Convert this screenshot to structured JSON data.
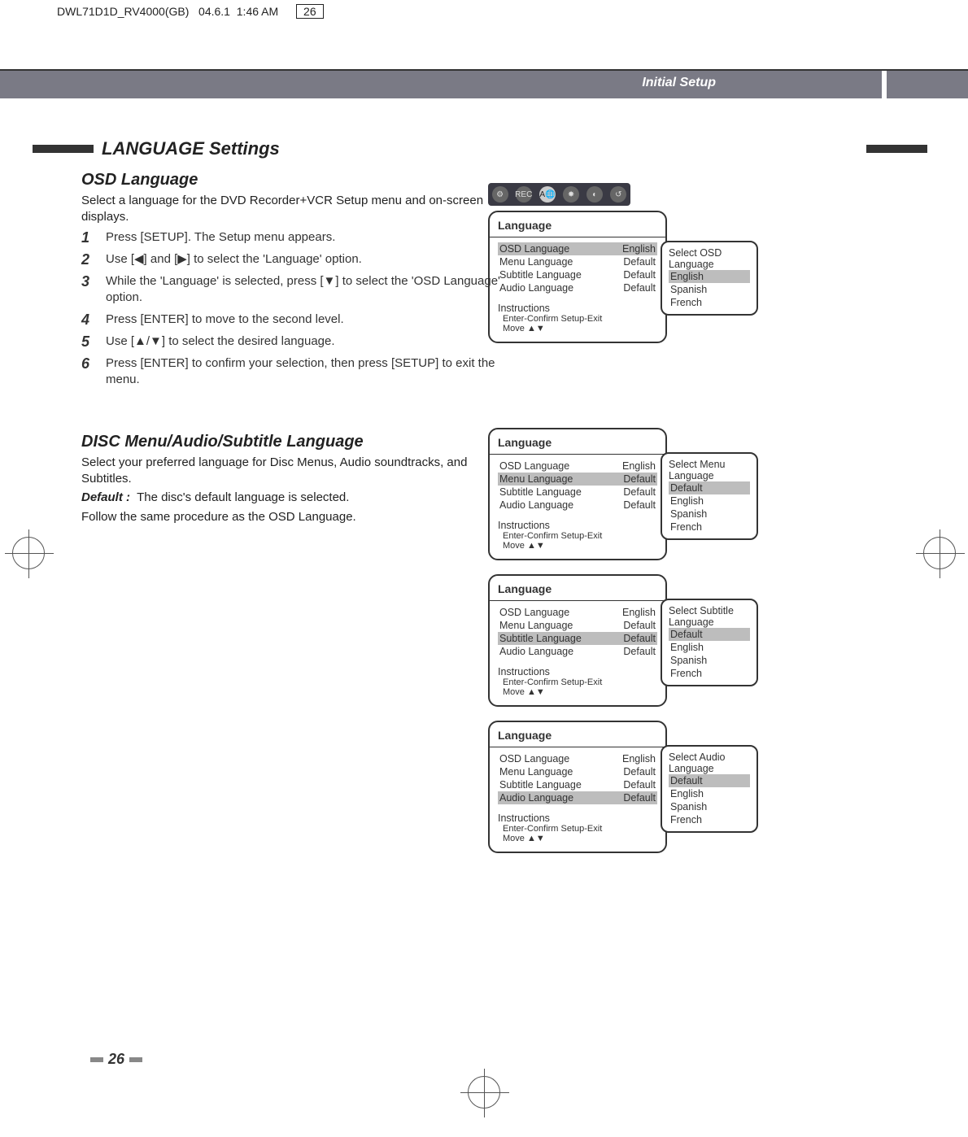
{
  "file_header": {
    "name": "DWL71D1D_RV4000(GB)",
    "date": "04.6.1",
    "time": "1:46 AM",
    "page_box": "26"
  },
  "header": {
    "breadcrumb": "Initial Setup"
  },
  "section_title": "LANGUAGE Settings",
  "osd": {
    "title": "OSD Language",
    "intro": "Select a language for the DVD Recorder+VCR Setup menu and on-screen displays.",
    "steps": [
      "Press [SETUP]. The Setup menu appears.",
      "Use [◀] and [▶] to select the 'Language' option.",
      "While the 'Language' is selected, press [▼] to select the 'OSD Language' option.",
      "Press [ENTER] to move to the second level.",
      "Use [▲/▼] to select the desired language.",
      "Press [ENTER] to confirm your selection, then press [SETUP] to exit the menu."
    ]
  },
  "disc": {
    "title": "DISC Menu/Audio/Subtitle Language",
    "intro": "Select your preferred language for Disc Menus, Audio soundtracks, and Subtitles.",
    "default_label": "Default :",
    "default_text": "The disc's default language is selected.",
    "follow": "Follow the same procedure as the OSD Language."
  },
  "panel_common": {
    "title": "Language",
    "rows": {
      "osd": "OSD Language",
      "menu": "Menu Language",
      "subtitle": "Subtitle Language",
      "audio": "Audio Language"
    },
    "vals": {
      "english": "English",
      "default": "Default"
    },
    "instr_title": "Instructions",
    "instr_line1": "Enter-Confirm   Setup-Exit",
    "instr_line2": "Move ▲▼"
  },
  "popups": {
    "osd": {
      "title": "Select OSD Language",
      "options": [
        "English",
        "Spanish",
        "French"
      ],
      "selected": "English"
    },
    "menu": {
      "title": "Select Menu Language",
      "options": [
        "Default",
        "English",
        "Spanish",
        "French"
      ],
      "selected": "Default"
    },
    "subtitle": {
      "title": "Select Subtitle Language",
      "options": [
        "Default",
        "English",
        "Spanish",
        "French"
      ],
      "selected": "Default"
    },
    "audio": {
      "title": "Select Audio Language",
      "options": [
        "Default",
        "English",
        "Spanish",
        "French"
      ],
      "selected": "Default"
    }
  },
  "page_number": "26"
}
